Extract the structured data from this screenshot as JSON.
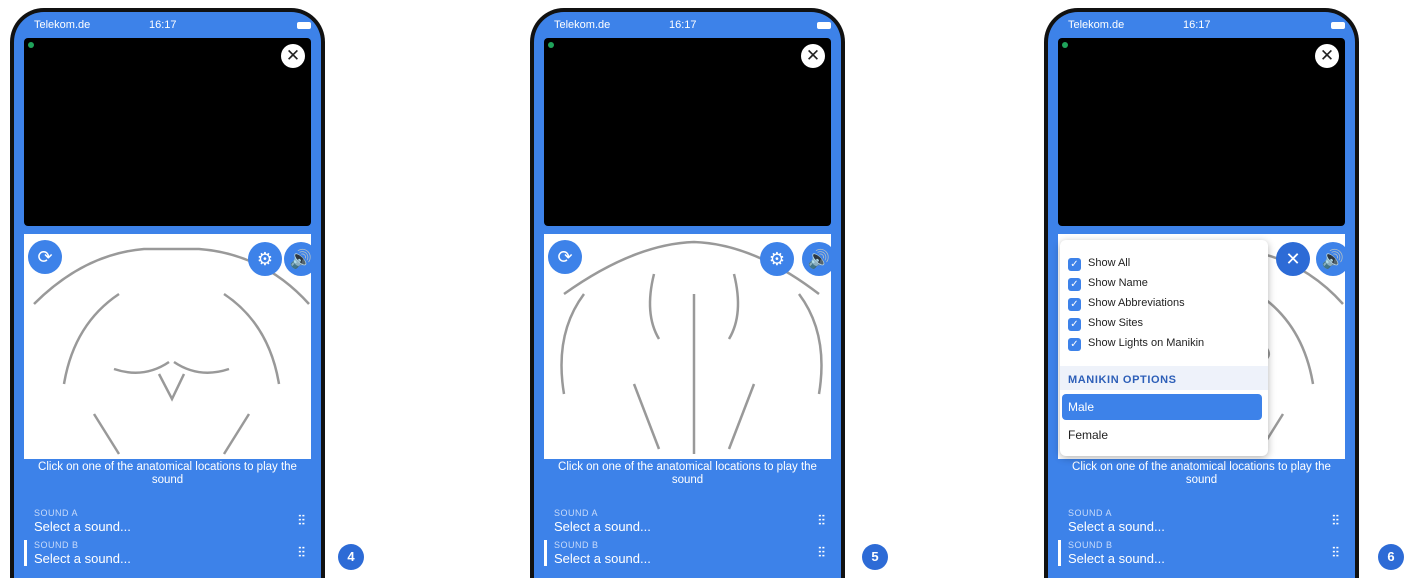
{
  "status": {
    "carrier": "Telekom.de",
    "time": "16:17"
  },
  "instruction": "Click on one of the anatomical locations to play the sound",
  "sound_a": {
    "label": "SOUND A",
    "value": "Select a sound..."
  },
  "sound_b": {
    "label": "SOUND B",
    "value": "Select a sound..."
  },
  "badges": [
    "4",
    "5",
    "6"
  ],
  "menu": {
    "items": [
      "Show All",
      "Show Name",
      "Show Abbreviations",
      "Show Sites",
      "Show Lights on Manikin"
    ],
    "section": "MANIKIN OPTIONS",
    "options": [
      "Male",
      "Female"
    ],
    "selected": "Male"
  },
  "colors": {
    "accent": "#3d82e9",
    "dot": "#1fa35b"
  }
}
